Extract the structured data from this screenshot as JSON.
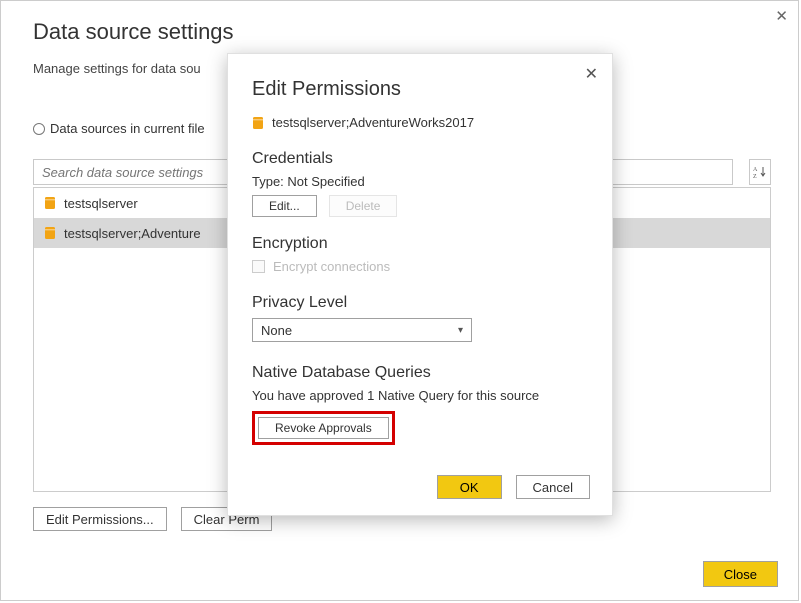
{
  "window": {
    "close_glyph": "✕"
  },
  "page": {
    "title": "Data source settings",
    "subtitle_prefix": "Manage settings for data sou",
    "scope_current_file": "Data sources in current file",
    "search_placeholder": "Search data source settings"
  },
  "sources": [
    {
      "label": "testsqlserver",
      "selected": false
    },
    {
      "label": "testsqlserver;Adventure",
      "selected": true
    }
  ],
  "bottom": {
    "edit_permissions": "Edit Permissions...",
    "clear_permissions_prefix": "Clear Perm",
    "close": "Close"
  },
  "modal": {
    "title": "Edit Permissions",
    "source_full": "testsqlserver;AdventureWorks2017",
    "credentials": {
      "heading": "Credentials",
      "type_label": "Type: Not Specified",
      "edit": "Edit...",
      "delete": "Delete"
    },
    "encryption": {
      "heading": "Encryption",
      "label": "Encrypt connections"
    },
    "privacy": {
      "heading": "Privacy Level",
      "value": "None"
    },
    "native": {
      "heading": "Native Database Queries",
      "text": "You have approved 1 Native Query for this source",
      "revoke": "Revoke Approvals"
    },
    "ok": "OK",
    "cancel": "Cancel",
    "close_glyph": "✕"
  },
  "icons": {
    "db_color": "#f2a414"
  }
}
